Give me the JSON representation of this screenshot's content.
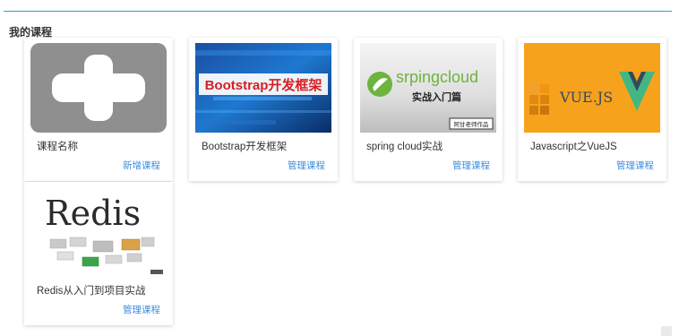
{
  "section": {
    "title": "我的课程"
  },
  "courses": [
    {
      "title": "课程名称",
      "action": "新增课程",
      "image": "add-placeholder"
    },
    {
      "title": "Bootstrap开发框架",
      "action": "管理课程",
      "image": "bootstrap-cover",
      "cover_text": "Bootstrap开发框架"
    },
    {
      "title": "spring cloud实战",
      "action": "管理课程",
      "image": "springcloud-cover",
      "cover_text": "srpingcloud",
      "cover_subtext": "实战入门篇",
      "cover_tag": "阿甘老师作品"
    },
    {
      "title": "Javascript之VueJS",
      "action": "管理课程",
      "image": "vuejs-cover",
      "cover_text": "VUE.JS"
    },
    {
      "title": "Redis从入门到项目实战",
      "action": "管理课程",
      "image": "redis-cover",
      "cover_text": "Redis"
    }
  ],
  "colors": {
    "accent_line": "#2aa7b8",
    "link": "#3d8ee0",
    "vue_orange": "#f7a21c",
    "vue_green": "#41b883",
    "vue_dark": "#35495e"
  }
}
